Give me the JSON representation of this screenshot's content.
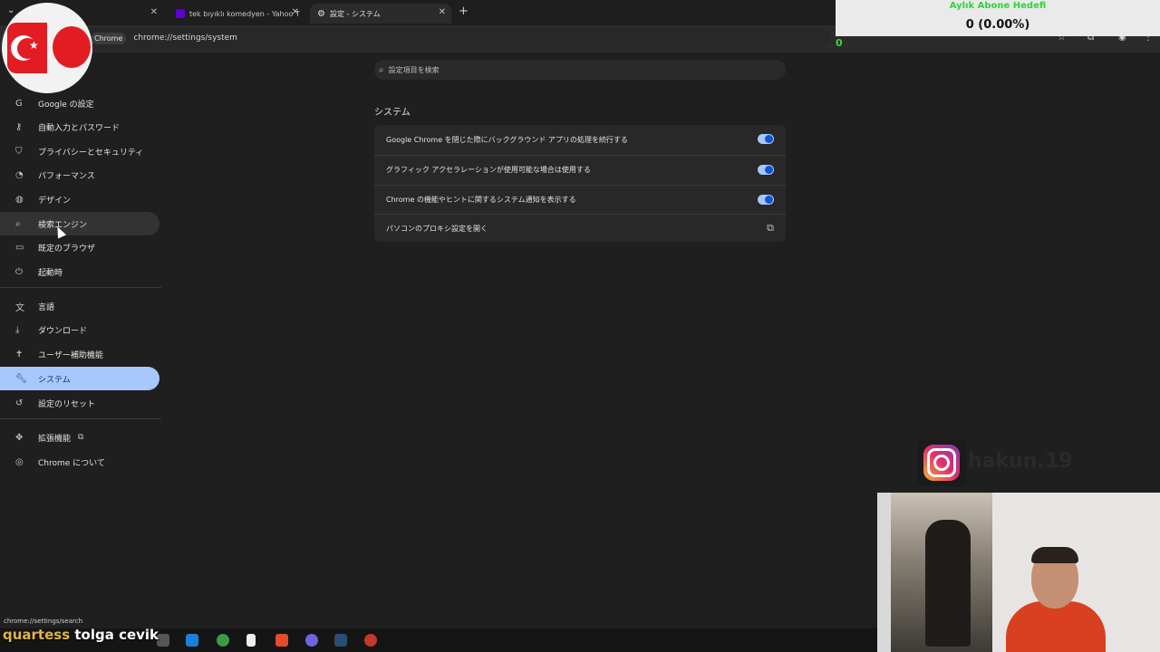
{
  "tabs": [
    {
      "title": "",
      "active": false
    },
    {
      "title": "tek bıyıklı komedyen - Yahoo T",
      "active": false
    },
    {
      "title": "設定 - システム",
      "active": true
    }
  ],
  "toolbar": {
    "chip": "Chrome",
    "url": "chrome://settings/system"
  },
  "overlay": {
    "goal_title": "Aylık Abone Hedefi",
    "goal_value": "0 (0.00%)",
    "counter": "0"
  },
  "search": {
    "placeholder": "設定項目を検索"
  },
  "sidebar": {
    "items": [
      {
        "label": "Google の設定",
        "icon": "google-icon"
      },
      {
        "label": "自動入力とパスワード",
        "icon": "key-icon"
      },
      {
        "label": "プライバシーとセキュリティ",
        "icon": "shield-icon"
      },
      {
        "label": "パフォーマンス",
        "icon": "speedometer-icon"
      },
      {
        "label": "デザイン",
        "icon": "palette-icon"
      },
      {
        "label": "検索エンジン",
        "icon": "search-icon"
      },
      {
        "label": "既定のブラウザ",
        "icon": "browser-icon"
      },
      {
        "label": "起動時",
        "icon": "power-icon"
      },
      {
        "label": "言語",
        "icon": "translate-icon"
      },
      {
        "label": "ダウンロード",
        "icon": "download-icon"
      },
      {
        "label": "ユーザー補助機能",
        "icon": "accessibility-icon"
      },
      {
        "label": "システム",
        "icon": "wrench-icon"
      },
      {
        "label": "設定のリセット",
        "icon": "reset-icon"
      },
      {
        "label": "拡張機能",
        "icon": "puzzle-icon"
      },
      {
        "label": "Chrome について",
        "icon": "chrome-icon"
      }
    ],
    "selected": "システム"
  },
  "section": {
    "title": "システム"
  },
  "settings": [
    {
      "label": "Google Chrome を閉じた際にバックグラウンド アプリの処理を続行する",
      "enabled": true
    },
    {
      "label": "グラフィック アクセラレーションが使用可能な場合は使用する",
      "enabled": true
    },
    {
      "label": "Chrome の機能やヒントに関するシステム通知を表示する",
      "enabled": true
    },
    {
      "label": "パソコンのプロキシ設定を開く"
    }
  ],
  "instagram": {
    "handle": "hakun.19"
  },
  "status_url": "chrome://settings/search",
  "stream_names": {
    "first": "quartess",
    "second": "tolga cevik"
  },
  "colors": {
    "accent": "#a8c7fa",
    "toggle_knob": "#0b57d0",
    "background": "#1f1f1f"
  }
}
